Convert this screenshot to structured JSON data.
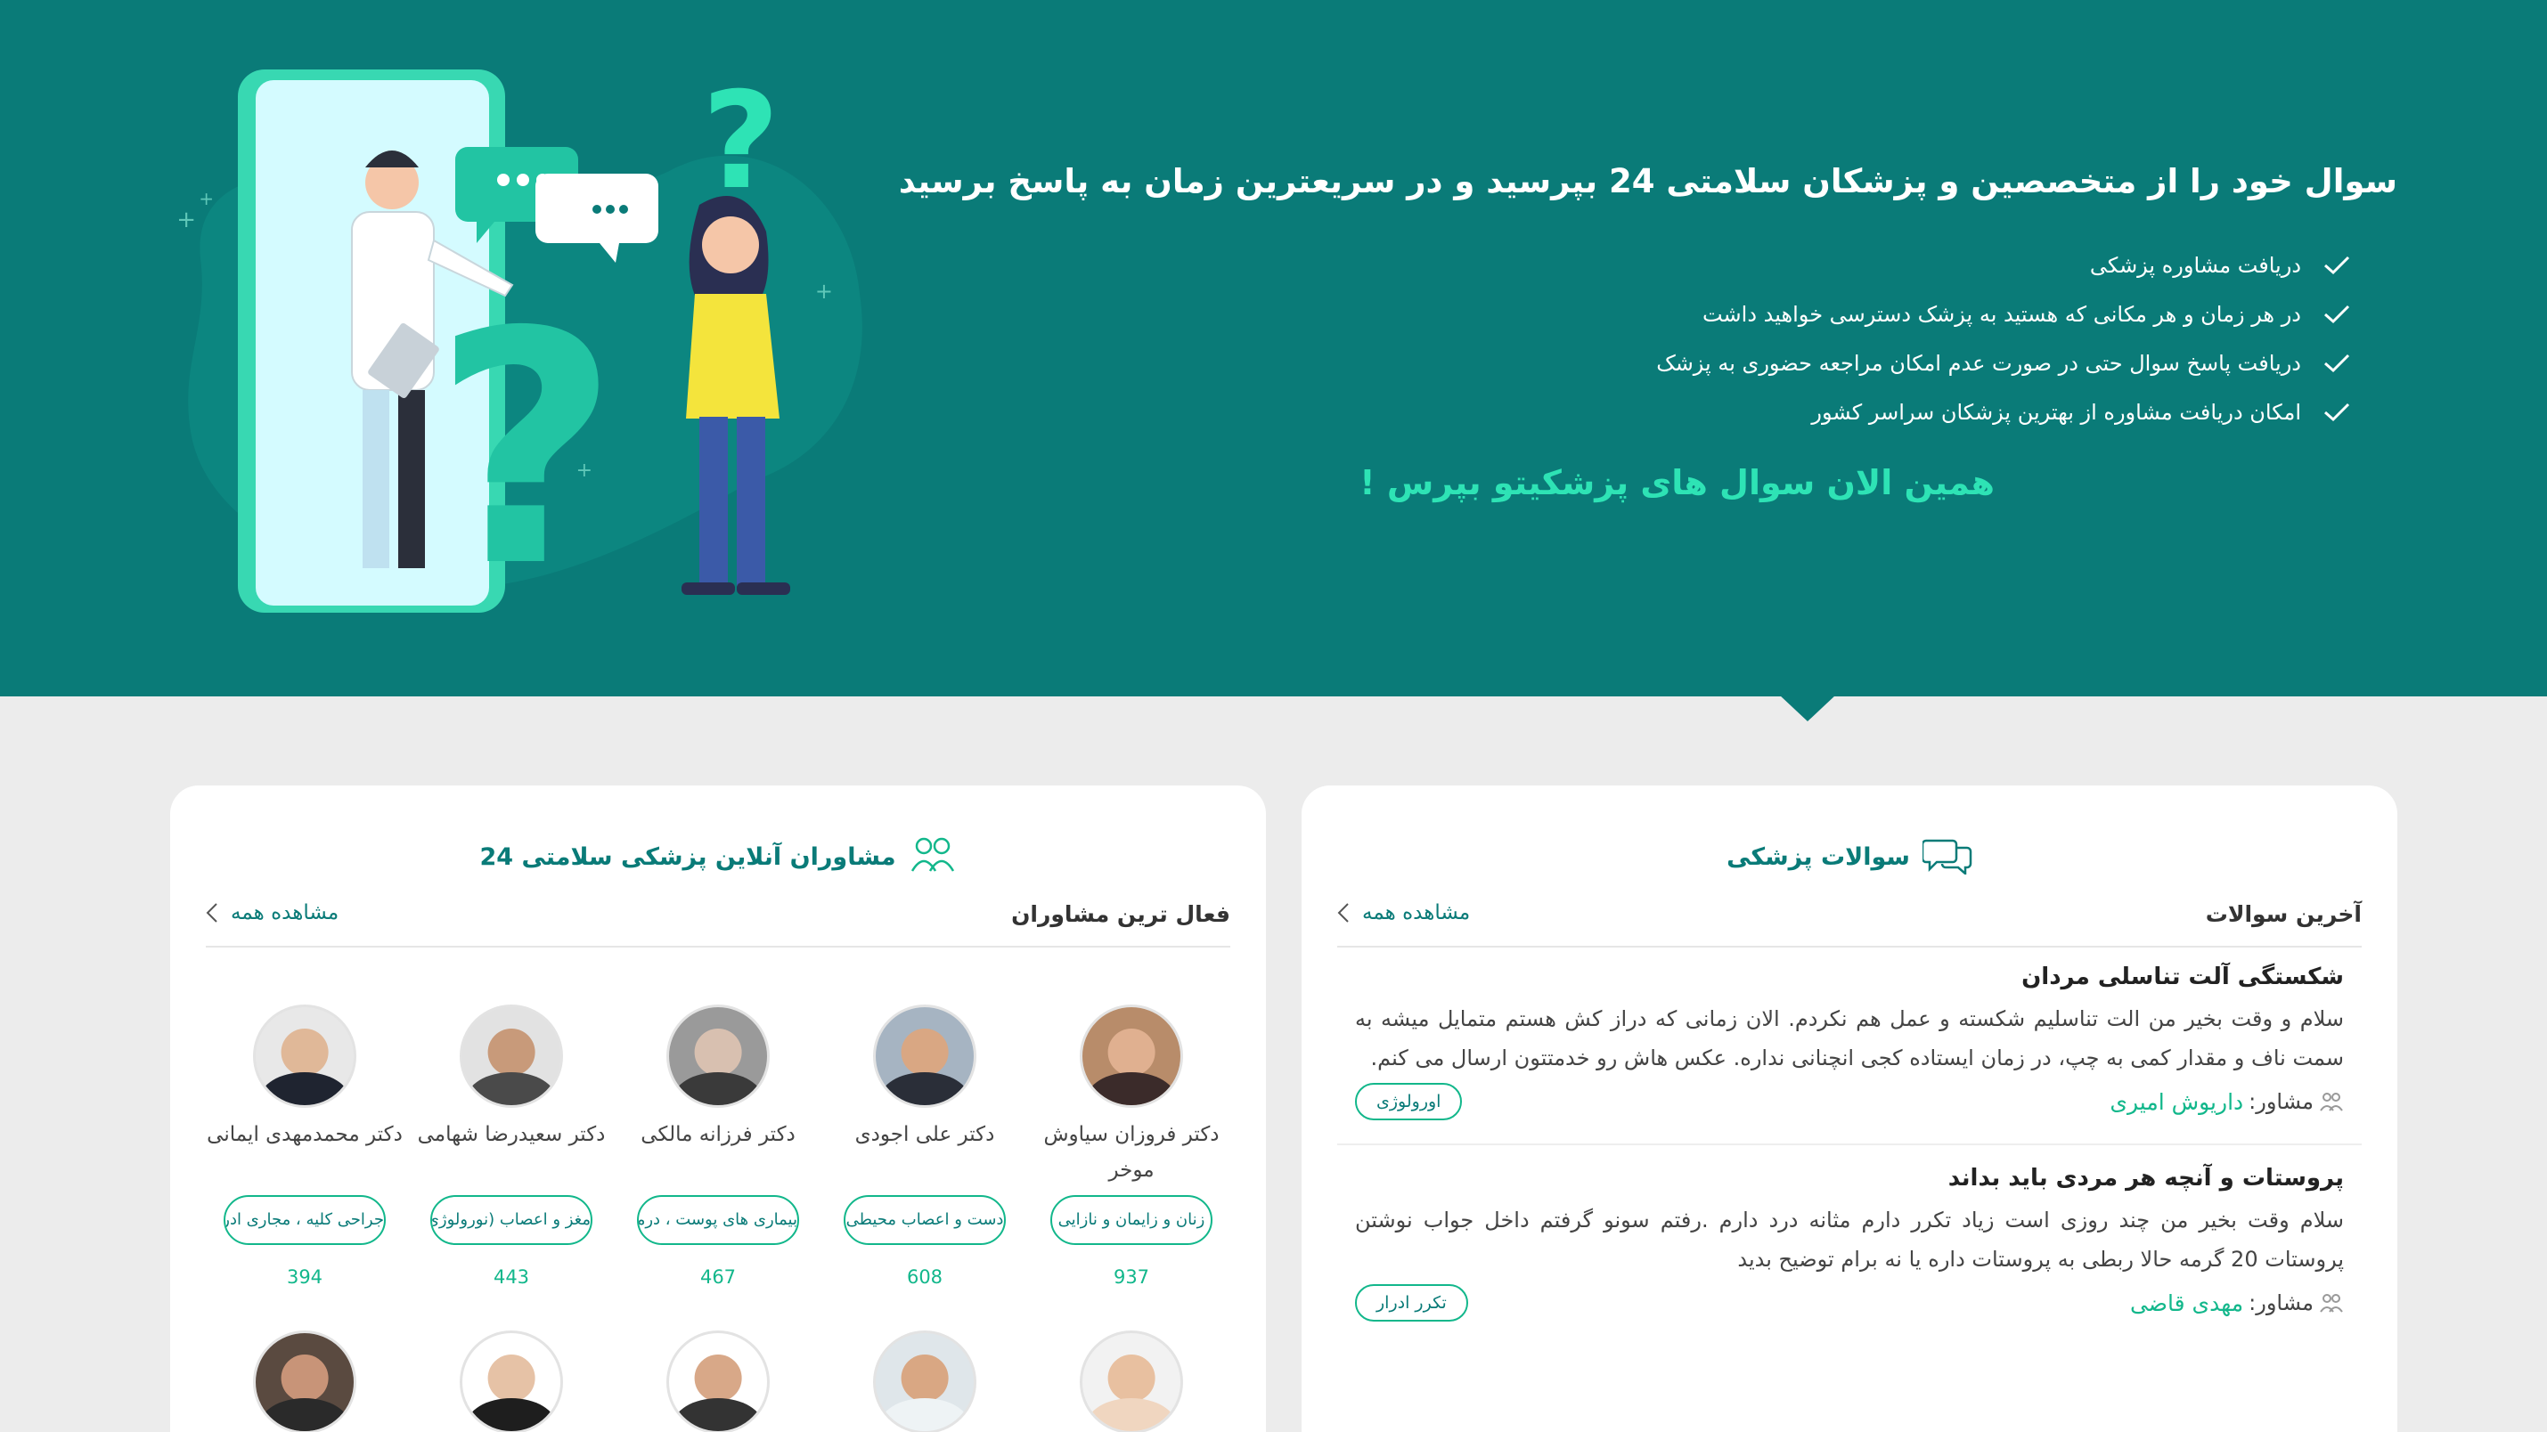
{
  "hero": {
    "title": "سوال خود را از متخصصین و پزشکان سلامتی 24 بپرسید و در سریعترین زمان به پاسخ برسید",
    "features": [
      "دریافت مشاوره پزشکی",
      "در هر زمان و هر مکانی که هستید به پزشک دسترسی خواهید داشت",
      "دریافت پاسخ سوال حتی در صورت عدم امکان مراجعه حضوری به پزشک",
      "امکان دریافت مشاوره از بهترین پزشکان سراسر کشور"
    ],
    "cta": "همین الان سوال های پزشکیتو بپرس !",
    "colors": {
      "background": "#0a7b78",
      "accent": "#2ee3b5"
    }
  },
  "questions_card": {
    "title": "سوالات پزشکی",
    "icon": "chat-bubbles-icon",
    "subhead": "آخرین سوالات",
    "see_all": "مشاهده همه",
    "items": [
      {
        "title": "شکستگی آلت تناسلی مردان",
        "body": "سلام و وقت بخیر من الت تناسلیم شکسته و عمل هم نکردم. الان زمانی که دراز کش هستم متمایل میشه به سمت ناف و مقدار کمی به چپ، در زمان ایستاده کجی انچنانی نداره. عکس هاش رو خدمتتون ارسال می کنم.",
        "advisor_label": "مشاور:",
        "advisor_name": "داریوش امیری",
        "tag": "اورولوژی"
      },
      {
        "title": "پروستات و آنچه هر مردی باید بداند",
        "body": "سلام وقت بخیر من چند روزی است زیاد تکرر دارم مثانه درد دارم .رفتم سونو گرفتم داخل جواب نوشتن پروستات 20 گرمه حالا ربطی به پروستات داره یا نه برام توضیح بدید",
        "advisor_label": "مشاور:",
        "advisor_name": "مهدی قاضی",
        "tag": "تکرر ادرار"
      }
    ]
  },
  "advisors_card": {
    "title": "مشاوران آنلاین پزشکی سلامتی 24",
    "icon": "people-icon",
    "subhead": "فعال ترین مشاوران",
    "see_all": "مشاهده همه",
    "advisors": [
      {
        "name": "دکتر فروزان سیاوش موخر",
        "specialty": "زنان و زایمان و نازایی",
        "count": "937"
      },
      {
        "name": "دکتر علی اجودی",
        "specialty": "دست و اعصاب محیطی",
        "count": "608"
      },
      {
        "name": "دکتر فرزانه مالکی",
        "specialty": "بیماری های پوست ، درماتولوژی",
        "count": "467"
      },
      {
        "name": "دکتر سعیدرضا شهامی",
        "specialty": "مغز و اعصاب (نورولوژی)",
        "count": "443"
      },
      {
        "name": "دکتر محمدمهدی ایمانی",
        "specialty": "جراحی کلیه ، مجاری ادرار",
        "count": "394"
      }
    ]
  }
}
